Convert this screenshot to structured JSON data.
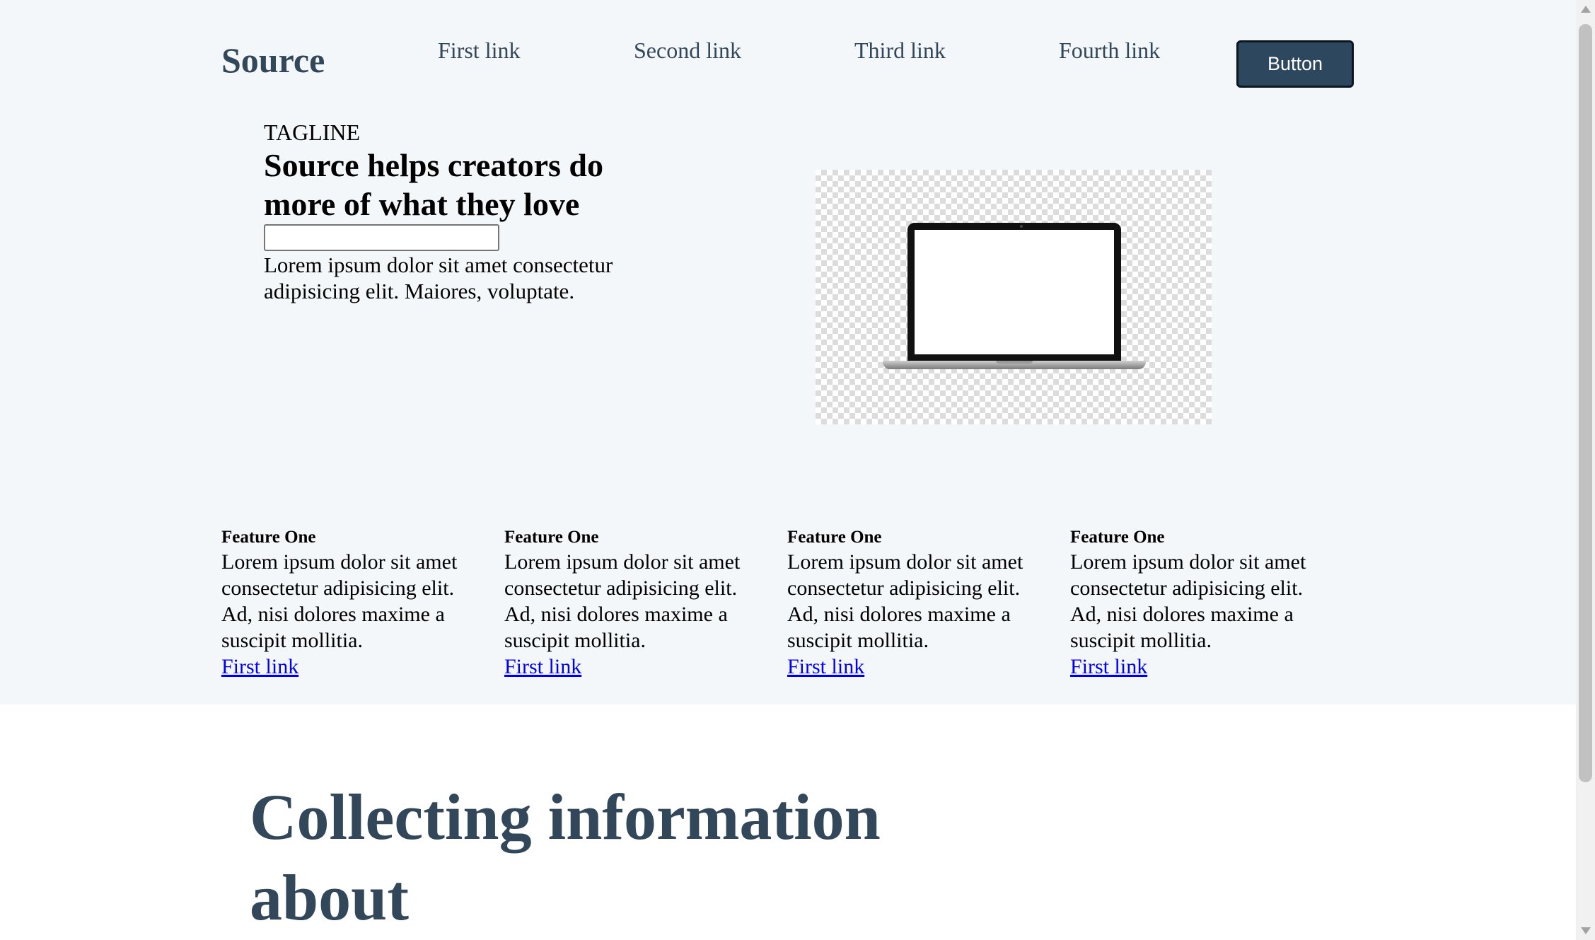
{
  "nav": {
    "brand": "Source",
    "links": [
      "First link",
      "Second link",
      "Third link",
      "Fourth link"
    ],
    "button_label": "Button"
  },
  "hero": {
    "tagline": "TAGLINE",
    "headline": "Source helps creators do more of what they love",
    "input_value": "",
    "description": "Lorem ipsum dolor sit amet consectetur adipisicing elit. Maiores, voluptate.",
    "image_icon": "laptop-image"
  },
  "features": [
    {
      "title": "Feature One",
      "text": "Lorem ipsum dolor sit amet consectetur adipisicing elit. Ad, nisi dolores maxime a suscipit mollitia.",
      "link": "First link"
    },
    {
      "title": "Feature One",
      "text": "Lorem ipsum dolor sit amet consectetur adipisicing elit. Ad, nisi dolores maxime a suscipit mollitia.",
      "link": "First link"
    },
    {
      "title": "Feature One",
      "text": "Lorem ipsum dolor sit amet consectetur adipisicing elit. Ad, nisi dolores maxime a suscipit mollitia.",
      "link": "First link"
    },
    {
      "title": "Feature One",
      "text": "Lorem ipsum dolor sit amet consectetur adipisicing elit. Ad, nisi dolores maxime a suscipit mollitia.",
      "link": "First link"
    }
  ],
  "section": {
    "heading": "Collecting information about"
  },
  "colors": {
    "brand": "#33475b",
    "button_bg": "#2d475e",
    "hero_bg": "#f4f7fa",
    "link": "#0000ee"
  }
}
